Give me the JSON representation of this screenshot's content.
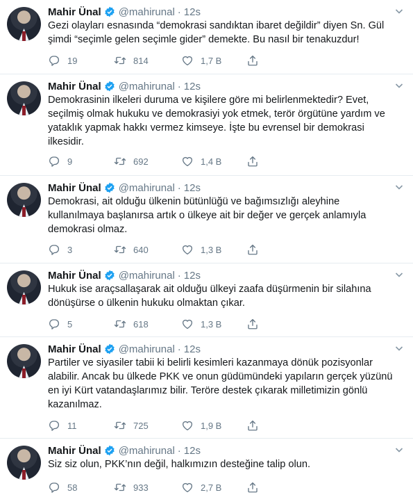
{
  "tweets": [
    {
      "name": "Mahir Ünal",
      "handle": "@mahirunal",
      "sep": "·",
      "time": "12s",
      "text": "Gezi olayları esnasında “demokrasi sandıktan ibaret değildir” diyen Sn. Gül şimdi “seçimle gelen seçimle gider” demekte. Bu nasıl bir tenakuzdur!",
      "replies": "19",
      "retweets": "814",
      "likes": "1,7 B"
    },
    {
      "name": "Mahir Ünal",
      "handle": "@mahirunal",
      "sep": "·",
      "time": "12s",
      "text": "Demokrasinin ilkeleri duruma ve kişilere göre mi belirlenmektedir? Evet, seçilmiş olmak hukuku ve demokrasiyi yok etmek, terör örgütüne yardım ve yataklık yapmak hakkı vermez kimseye. İşte bu evrensel bir demokrasi ilkesidir.",
      "replies": "9",
      "retweets": "692",
      "likes": "1,4 B"
    },
    {
      "name": "Mahir Ünal",
      "handle": "@mahirunal",
      "sep": "·",
      "time": "12s",
      "text": "Demokrasi, ait olduğu ülkenin bütünlüğü ve bağımsızlığı aleyhine kullanılmaya başlanırsa artık o ülkeye ait bir değer ve gerçek anlamıyla demokrasi olmaz.",
      "replies": "3",
      "retweets": "640",
      "likes": "1,3 B"
    },
    {
      "name": "Mahir Ünal",
      "handle": "@mahirunal",
      "sep": "·",
      "time": "12s",
      "text": "Hukuk ise araçsallaşarak ait olduğu ülkeyi zaafa düşürmenin bir silahına dönüşürse o ülkenin hukuku olmaktan çıkar.",
      "replies": "5",
      "retweets": "618",
      "likes": "1,3 B"
    },
    {
      "name": "Mahir Ünal",
      "handle": "@mahirunal",
      "sep": "·",
      "time": "12s",
      "text": "Partiler ve siyasiler tabii ki belirli kesimleri kazanmaya dönük pozisyonlar alabilir. Ancak bu ülkede PKK ve onun güdümündeki yapıların gerçek yüzünü en iyi Kürt vatandaşlarımız bilir. Teröre destek çıkarak milletimizin gönlü kazanılmaz.",
      "replies": "11",
      "retweets": "725",
      "likes": "1,9 B"
    },
    {
      "name": "Mahir Ünal",
      "handle": "@mahirunal",
      "sep": "·",
      "time": "12s",
      "text": "Siz siz olun, PKK’nın değil, halkımızın desteğine talip olun.",
      "replies": "58",
      "retweets": "933",
      "likes": "2,7 B"
    }
  ]
}
